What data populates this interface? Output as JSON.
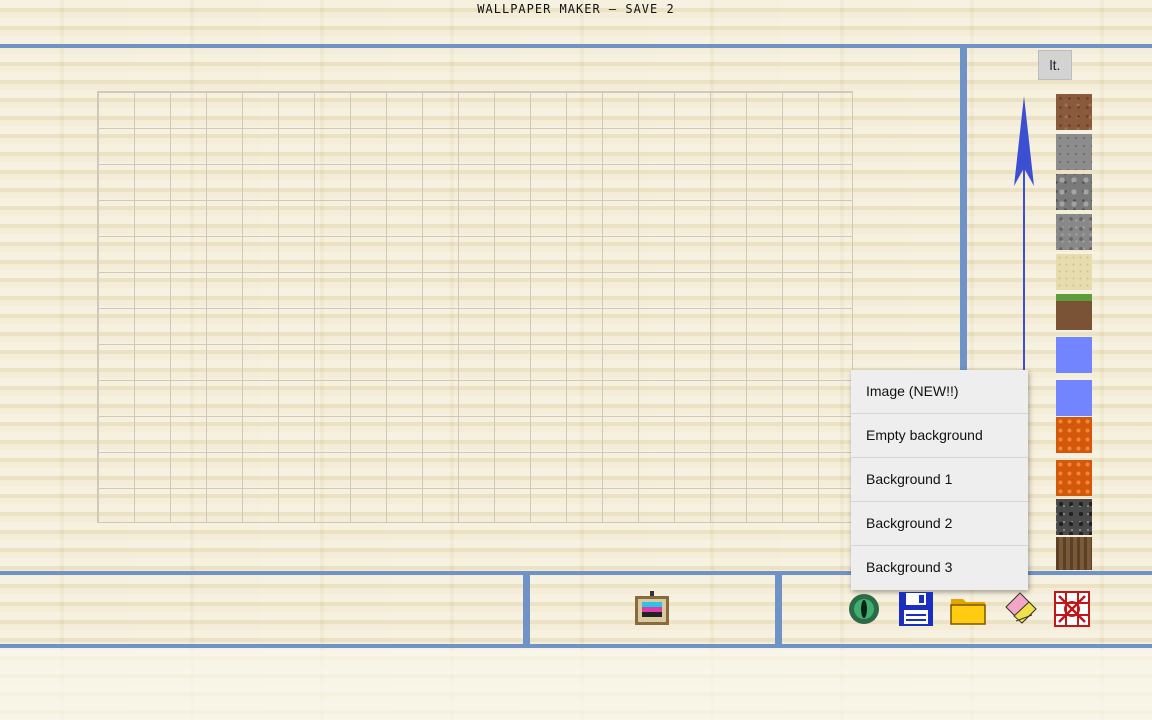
{
  "window": {
    "title": "WALLPAPER MAKER – SAVE 2"
  },
  "sidebar": {
    "lt_label": "lt."
  },
  "palette": {
    "blocks": [
      {
        "name": "dirt-block",
        "color": "#8a5a3c"
      },
      {
        "name": "stone-block",
        "color": "#8c8c8c"
      },
      {
        "name": "cobblestone-block",
        "color": "#7a7a7a"
      },
      {
        "name": "gravel-block",
        "color": "#888888"
      },
      {
        "name": "sand-block",
        "color": "#e6dcae"
      },
      {
        "name": "grass-block",
        "color": "#7a5236"
      },
      {
        "name": "water-block",
        "color": "#7384ff"
      },
      {
        "name": "water-block-2",
        "color": "#7384ff"
      },
      {
        "name": "lava-block",
        "color": "#d4570e"
      },
      {
        "name": "lava-block-2",
        "color": "#d4570e"
      },
      {
        "name": "bedrock-block",
        "color": "#4a4a4a"
      },
      {
        "name": "wood-log-block",
        "color": "#6b4e2e"
      }
    ]
  },
  "menu": {
    "items": [
      {
        "label": "Image (NEW!!)"
      },
      {
        "label": "Empty background"
      },
      {
        "label": "Background 1"
      },
      {
        "label": "Background 2"
      },
      {
        "label": "Background 3"
      }
    ]
  },
  "toolbar": {
    "icons": [
      "painting-icon",
      "eye-icon",
      "floppy-disk-icon",
      "folder-icon",
      "eraser-icon",
      "clear-grid-icon"
    ]
  },
  "colors": {
    "accent_line": "#6f93c6",
    "arrow": "#3d4fd1"
  }
}
